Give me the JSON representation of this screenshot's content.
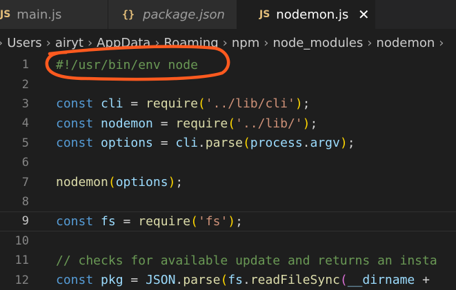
{
  "tabs": [
    {
      "icon": "JS",
      "label": "main.js"
    },
    {
      "icon": "{}",
      "label": "package.json"
    },
    {
      "icon": "JS",
      "label": "nodemon.js",
      "close": "✕"
    }
  ],
  "breadcrumb": {
    "items": [
      "Users",
      "airyt",
      "AppData",
      "Roaming",
      "npm",
      "node_modules",
      "nodemon"
    ],
    "separator": "›"
  },
  "editor": {
    "active_line": 9,
    "lines": [
      {
        "n": "1",
        "tokens": [
          {
            "t": "cmt",
            "v": "#!/usr/bin/env node"
          }
        ]
      },
      {
        "n": "2",
        "tokens": []
      },
      {
        "n": "3",
        "tokens": [
          {
            "t": "kw",
            "v": "const"
          },
          {
            "t": "plain",
            "v": " "
          },
          {
            "t": "var",
            "v": "cli"
          },
          {
            "t": "plain",
            "v": " = "
          },
          {
            "t": "fn",
            "v": "require"
          },
          {
            "t": "b1",
            "v": "("
          },
          {
            "t": "str",
            "v": "'../lib/cli'"
          },
          {
            "t": "b1",
            "v": ")"
          },
          {
            "t": "plain",
            "v": ";"
          }
        ]
      },
      {
        "n": "4",
        "tokens": [
          {
            "t": "kw",
            "v": "const"
          },
          {
            "t": "plain",
            "v": " "
          },
          {
            "t": "var",
            "v": "nodemon"
          },
          {
            "t": "plain",
            "v": " = "
          },
          {
            "t": "fn",
            "v": "require"
          },
          {
            "t": "b1",
            "v": "("
          },
          {
            "t": "str",
            "v": "'../lib/'"
          },
          {
            "t": "b1",
            "v": ")"
          },
          {
            "t": "plain",
            "v": ";"
          }
        ]
      },
      {
        "n": "5",
        "tokens": [
          {
            "t": "kw",
            "v": "const"
          },
          {
            "t": "plain",
            "v": " "
          },
          {
            "t": "var",
            "v": "options"
          },
          {
            "t": "plain",
            "v": " = "
          },
          {
            "t": "var",
            "v": "cli"
          },
          {
            "t": "plain",
            "v": "."
          },
          {
            "t": "fn",
            "v": "parse"
          },
          {
            "t": "b1",
            "v": "("
          },
          {
            "t": "var",
            "v": "process"
          },
          {
            "t": "plain",
            "v": "."
          },
          {
            "t": "var",
            "v": "argv"
          },
          {
            "t": "b1",
            "v": ")"
          },
          {
            "t": "plain",
            "v": ";"
          }
        ]
      },
      {
        "n": "6",
        "tokens": []
      },
      {
        "n": "7",
        "tokens": [
          {
            "t": "fn",
            "v": "nodemon"
          },
          {
            "t": "b1",
            "v": "("
          },
          {
            "t": "var",
            "v": "options"
          },
          {
            "t": "b1",
            "v": ")"
          },
          {
            "t": "plain",
            "v": ";"
          }
        ]
      },
      {
        "n": "8",
        "tokens": []
      },
      {
        "n": "9",
        "tokens": [
          {
            "t": "kw",
            "v": "const"
          },
          {
            "t": "plain",
            "v": " "
          },
          {
            "t": "var",
            "v": "fs"
          },
          {
            "t": "plain",
            "v": " = "
          },
          {
            "t": "fn",
            "v": "require"
          },
          {
            "t": "b1",
            "v": "("
          },
          {
            "t": "str",
            "v": "'fs'"
          },
          {
            "t": "b1",
            "v": ")"
          },
          {
            "t": "plain",
            "v": ";"
          }
        ]
      },
      {
        "n": "10",
        "tokens": []
      },
      {
        "n": "11",
        "tokens": [
          {
            "t": "cmt",
            "v": "// checks for available update and returns an insta"
          }
        ]
      },
      {
        "n": "12",
        "tokens": [
          {
            "t": "kw",
            "v": "const"
          },
          {
            "t": "plain",
            "v": " "
          },
          {
            "t": "var",
            "v": "pkg"
          },
          {
            "t": "plain",
            "v": " = "
          },
          {
            "t": "var",
            "v": "JSON"
          },
          {
            "t": "plain",
            "v": "."
          },
          {
            "t": "fn",
            "v": "parse"
          },
          {
            "t": "b1",
            "v": "("
          },
          {
            "t": "var",
            "v": "fs"
          },
          {
            "t": "plain",
            "v": "."
          },
          {
            "t": "fn",
            "v": "readFileSync"
          },
          {
            "t": "b2",
            "v": "("
          },
          {
            "t": "var",
            "v": "__dirname"
          },
          {
            "t": "plain",
            "v": " +"
          }
        ]
      }
    ]
  },
  "colors": {
    "annotation_stroke": "#ff5a1f"
  }
}
